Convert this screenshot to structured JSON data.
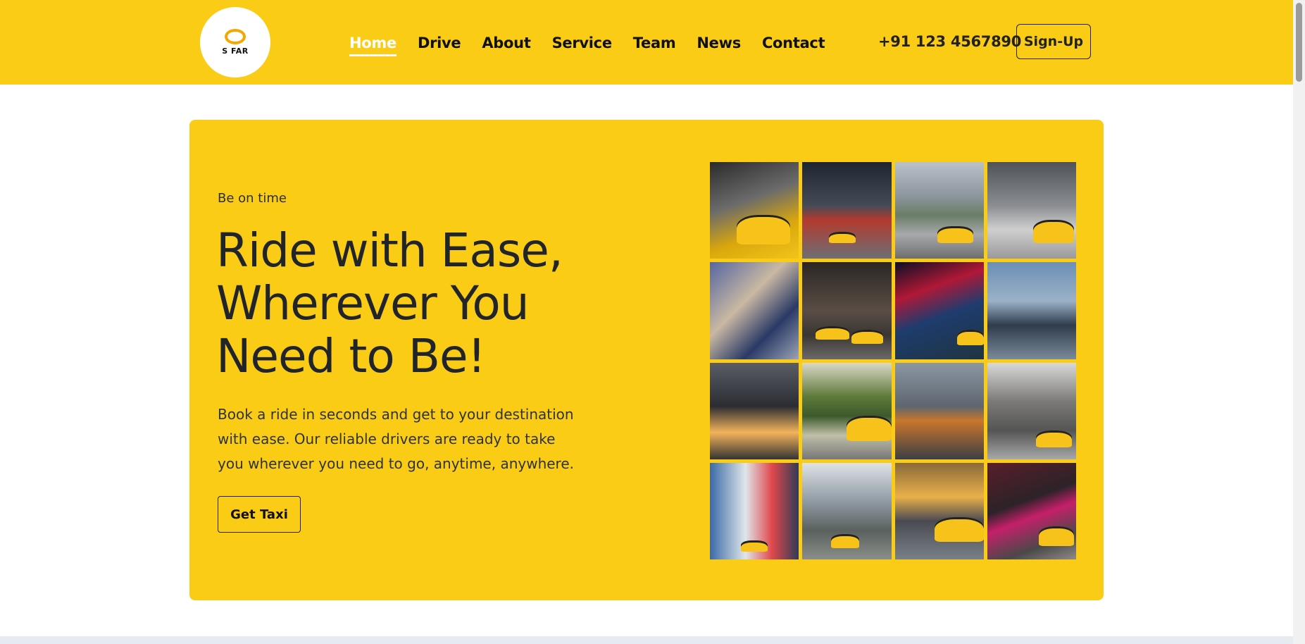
{
  "brand": {
    "logo_text": "S FAR"
  },
  "nav": {
    "items": [
      {
        "label": "Home",
        "active": true
      },
      {
        "label": "Drive",
        "active": false
      },
      {
        "label": "About",
        "active": false
      },
      {
        "label": "Service",
        "active": false
      },
      {
        "label": "Team",
        "active": false
      },
      {
        "label": "News",
        "active": false
      },
      {
        "label": "Contact",
        "active": false
      }
    ]
  },
  "header": {
    "phone": "+91 123 4567890",
    "signup_label": "Sign-Up"
  },
  "hero": {
    "eyebrow": "Be on time",
    "headline": "Ride with Ease, Wherever You Need to Be!",
    "description": "Book a ride in seconds and get to your destination with ease. Our reliable drivers are ready to take you wherever you need to go, anytime, anywhere.",
    "cta_label": "Get Taxi"
  },
  "gallery": {
    "images": [
      "taxi-roof-sign-night",
      "times-square-street",
      "city-skyline-cab",
      "street-crossing-cab",
      "passenger-hailing-phone",
      "cabs-between-towers",
      "neon-night-street",
      "pedestrian-hailing-cab",
      "sunset-avenue",
      "vintage-cab-palms",
      "orange-cab-rainy-city",
      "wet-street-cab",
      "times-square-cab-front",
      "cab-downtown",
      "motion-blur-cab",
      "night-neon-cab"
    ]
  },
  "colors": {
    "accent": "#facc15",
    "text": "#212529",
    "white": "#ffffff"
  }
}
